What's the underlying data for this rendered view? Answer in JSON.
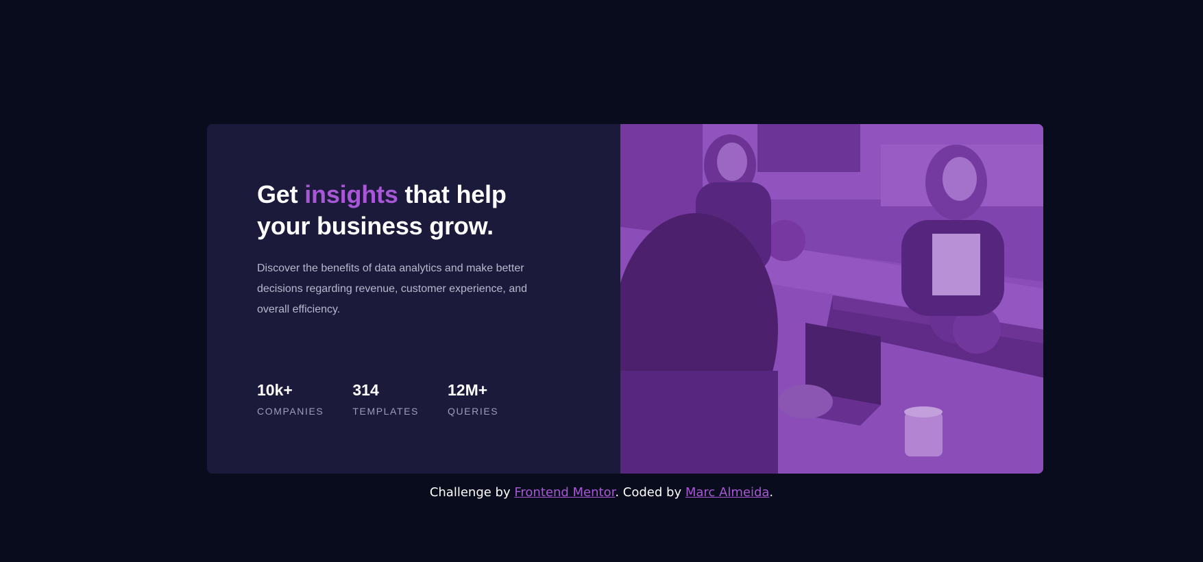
{
  "colors": {
    "page_background": "#090c1c",
    "card_background": "#1b1a3b",
    "accent": "#a857d6",
    "image_overlay": "#8a4cb8"
  },
  "headline": {
    "before": "Get",
    "accent": "insights",
    "after": "that help your business grow."
  },
  "description": "Discover the benefits of data analytics and make better decisions regarding revenue, customer experience, and overall efficiency.",
  "stats": [
    {
      "value": "10k+",
      "label": "COMPANIES"
    },
    {
      "value": "314",
      "label": "TEMPLATES"
    },
    {
      "value": "12M+",
      "label": "QUERIES"
    }
  ],
  "image": {
    "subject": "people-working-at-table-photo"
  },
  "footer": {
    "prefix": "Challenge by",
    "link1": "Frontend Mentor",
    "middle": ". Coded by",
    "link2": "Marc Almeida",
    "suffix": "."
  }
}
